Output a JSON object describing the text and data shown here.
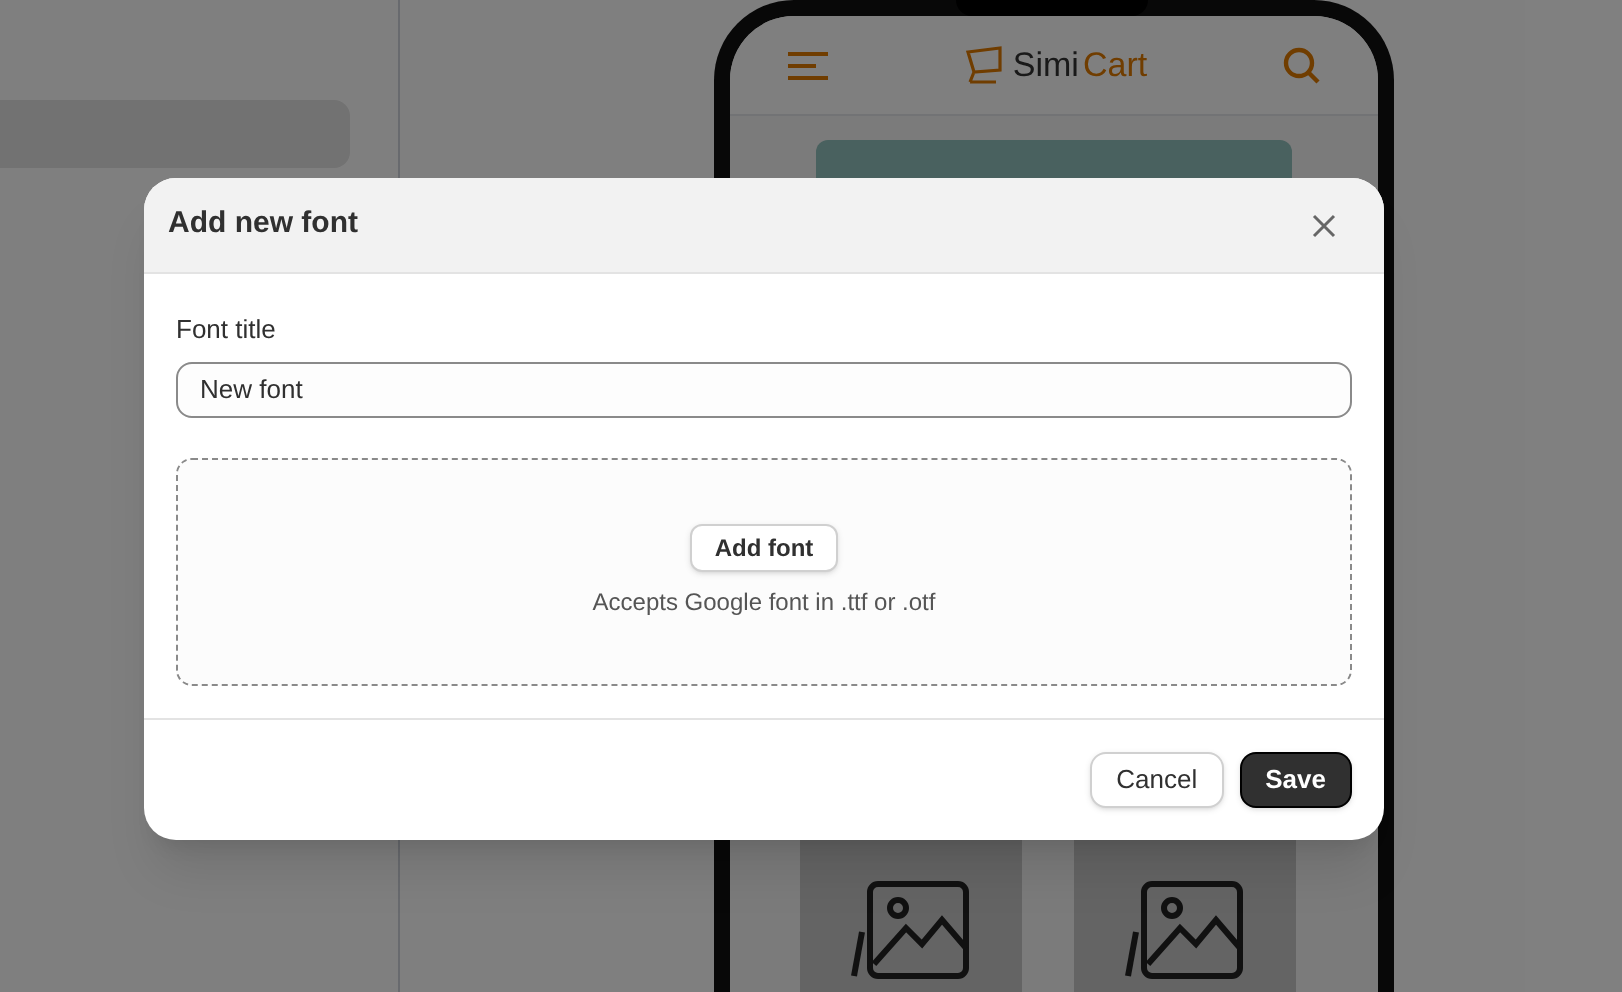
{
  "background": {
    "logo": {
      "part_1": "Simi",
      "part_2": "Cart"
    }
  },
  "dialog": {
    "title": "Add new font",
    "field": {
      "label": "Font title",
      "value": "New font"
    },
    "dropzone": {
      "button": "Add font",
      "hint": "Accepts Google font in .ttf or .otf"
    },
    "buttons": [
      {
        "label": "Cancel",
        "kind": "secondary"
      },
      {
        "label": "Save",
        "kind": "primary"
      }
    ]
  }
}
